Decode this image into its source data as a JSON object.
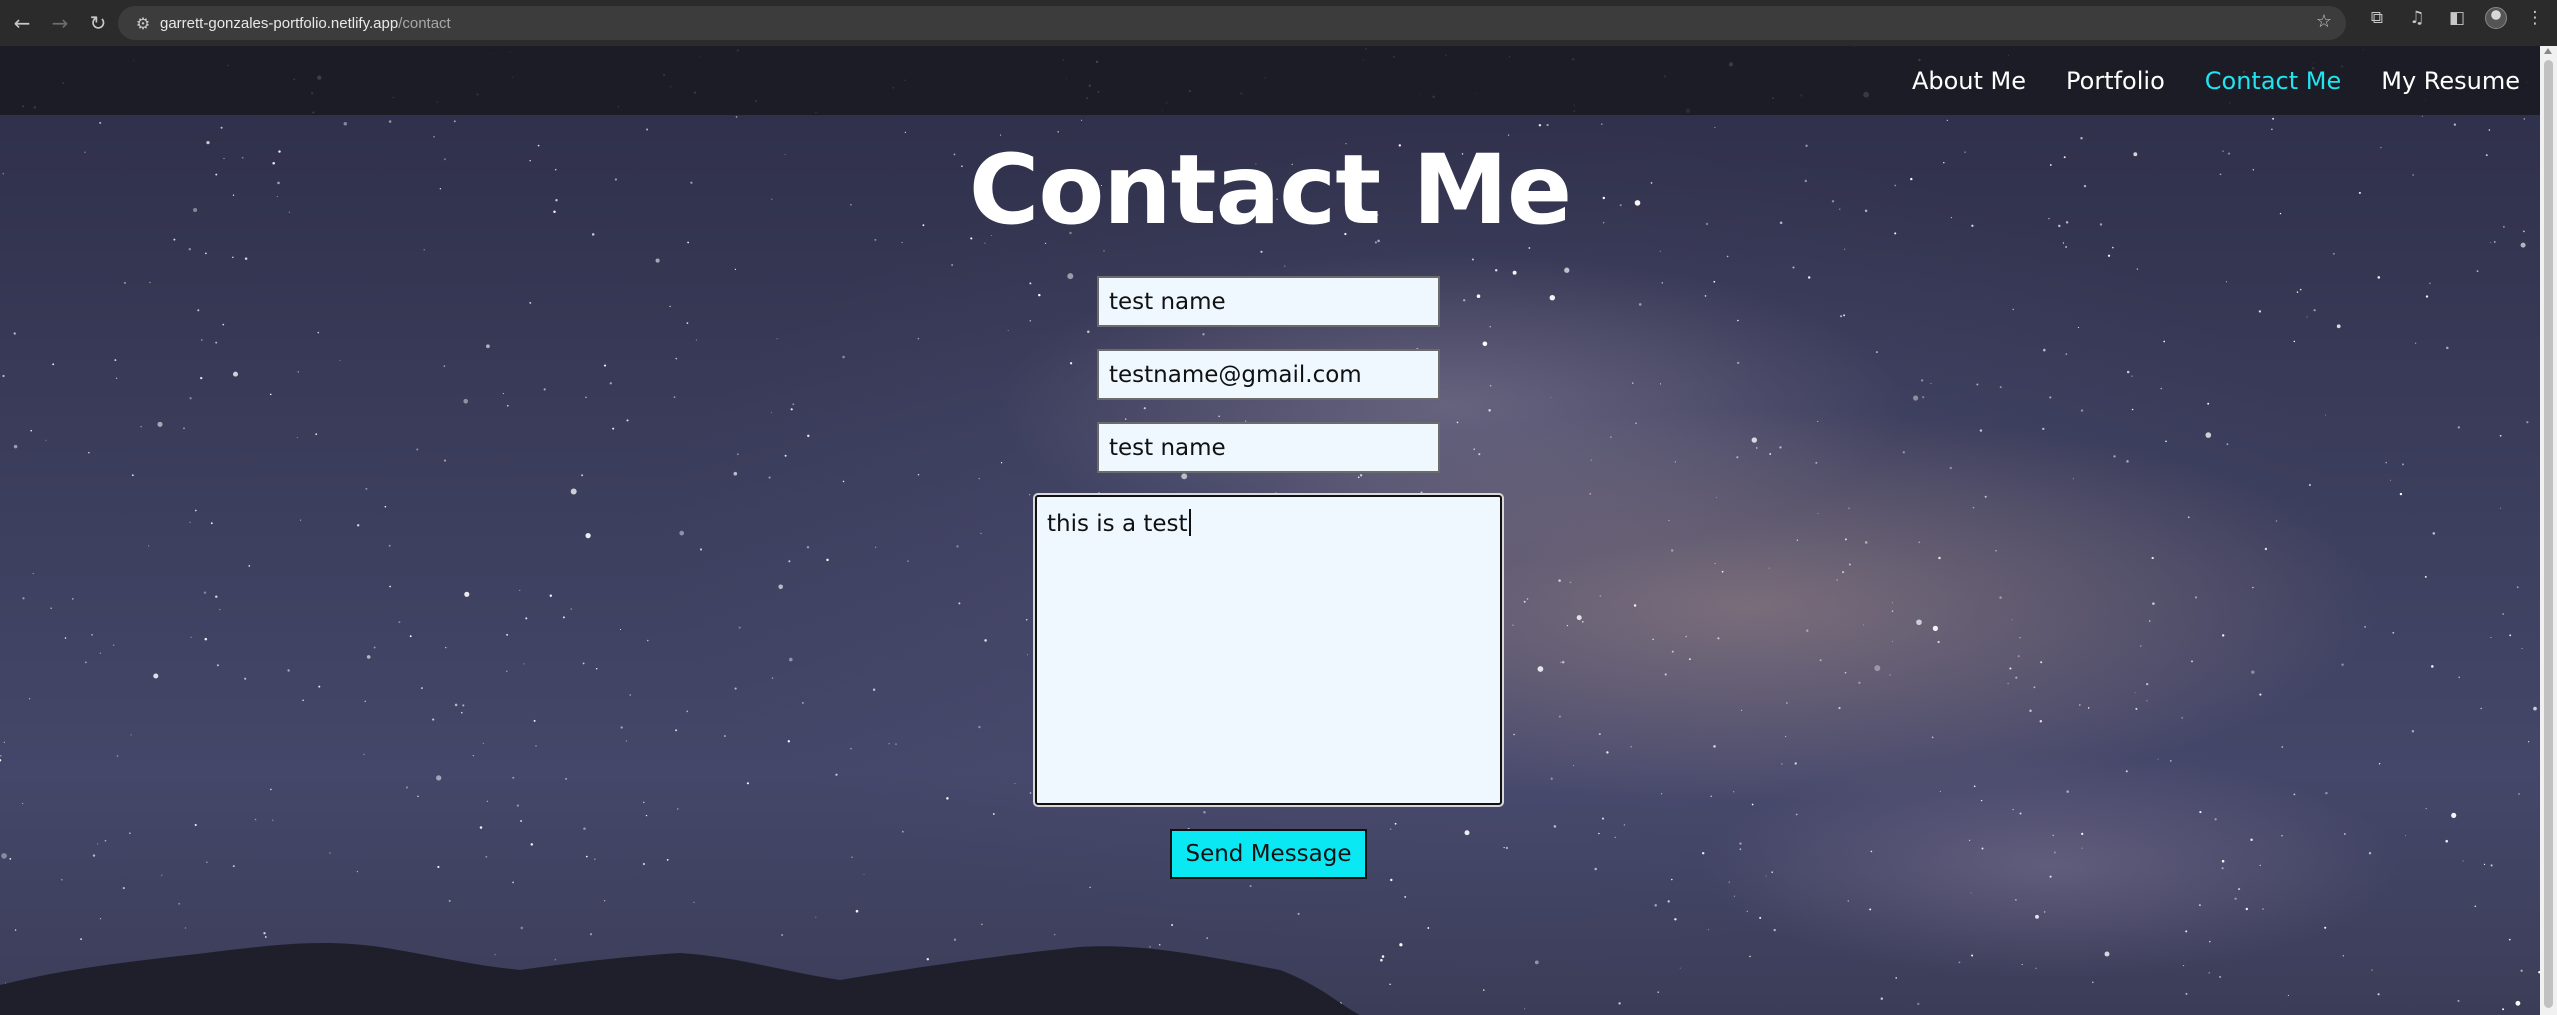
{
  "browser": {
    "back_icon": "arrow-left-icon",
    "forward_icon": "arrow-right-icon",
    "reload_icon": "reload-icon",
    "url_host": "garrett-gonzales-portfolio.netlify.app",
    "url_path": "/contact",
    "bookmark_icon": "star-icon"
  },
  "nav": {
    "links": [
      {
        "label": "About Me"
      },
      {
        "label": "Portfolio"
      },
      {
        "label": "Contact Me",
        "active": true
      },
      {
        "label": "My Resume"
      }
    ],
    "active_color": "#22e3f0"
  },
  "page": {
    "title": "Contact Me"
  },
  "form": {
    "name_value": "test name",
    "email_value": "testname@gmail.com",
    "subject_value": "test name",
    "message_value": "this is a test",
    "send_label": "Send Message",
    "send_color": "#0ae8f4"
  }
}
